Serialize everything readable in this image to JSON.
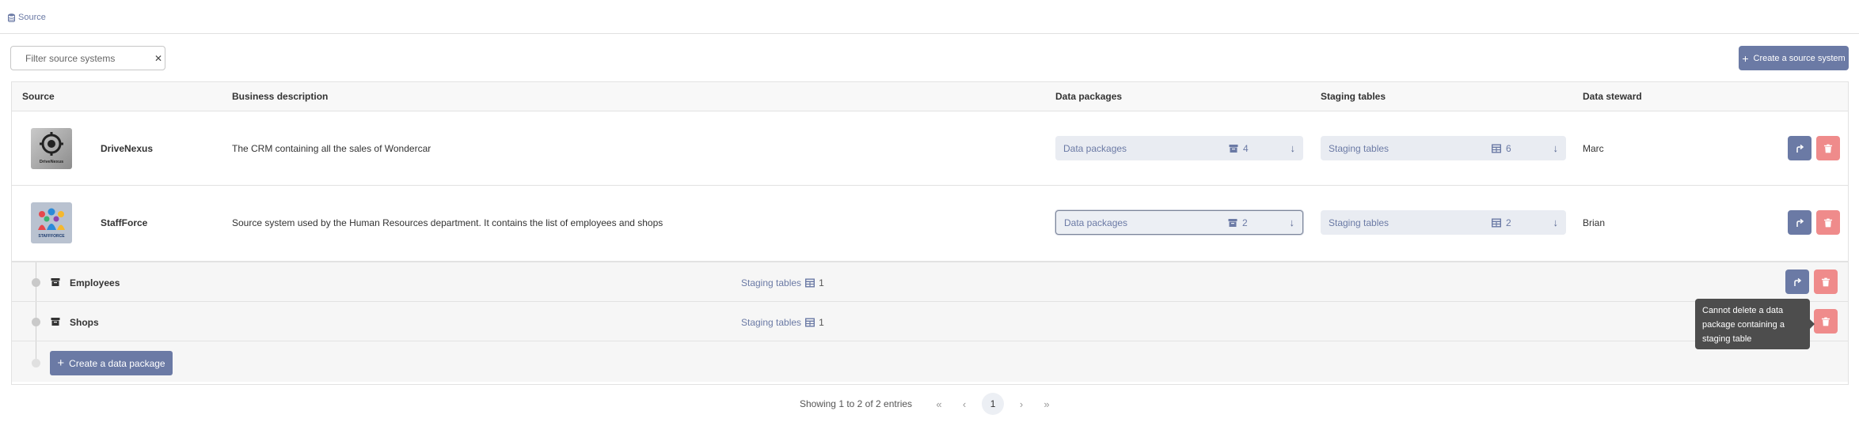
{
  "breadcrumb": {
    "label": "Source"
  },
  "search": {
    "placeholder": "Filter source systems",
    "clear": "✕"
  },
  "actions": {
    "create_source": "Create a source system"
  },
  "table": {
    "headers": {
      "source": "Source",
      "description": "Business description",
      "data_packages": "Data packages",
      "staging_tables": "Staging tables",
      "steward": "Data steward"
    },
    "rows": [
      {
        "name": "DriveNexus",
        "logo_text": "DriveNexus",
        "description": "The CRM containing all the sales of Wondercar",
        "data_packages_label": "Data packages",
        "data_packages_count": "4",
        "staging_tables_label": "Staging tables",
        "staging_tables_count": "6",
        "steward": "Marc"
      },
      {
        "name": "StaffForce",
        "logo_text": "STAFFFORCE",
        "description": "Source system used by the Human Resources department. It contains the list of employees and shops",
        "data_packages_label": "Data packages",
        "data_packages_count": "2",
        "staging_tables_label": "Staging tables",
        "staging_tables_count": "2",
        "steward": "Brian"
      }
    ],
    "packages": [
      {
        "name": "Employees",
        "staging_label": "Staging tables",
        "staging_count": "1"
      },
      {
        "name": "Shops",
        "staging_label": "Staging tables",
        "staging_count": "1"
      }
    ],
    "create_package": "Create a data package"
  },
  "tooltip": {
    "text": "Cannot delete a data package containing a staging table"
  },
  "pagination": {
    "info": "Showing 1 to 2 of 2 entries",
    "first": "«",
    "prev": "‹",
    "current": "1",
    "next": "›",
    "last": "»"
  },
  "colors": {
    "accent": "#6b7aa5",
    "danger": "#ef8b8b",
    "tooltip": "#4d4d4d"
  }
}
